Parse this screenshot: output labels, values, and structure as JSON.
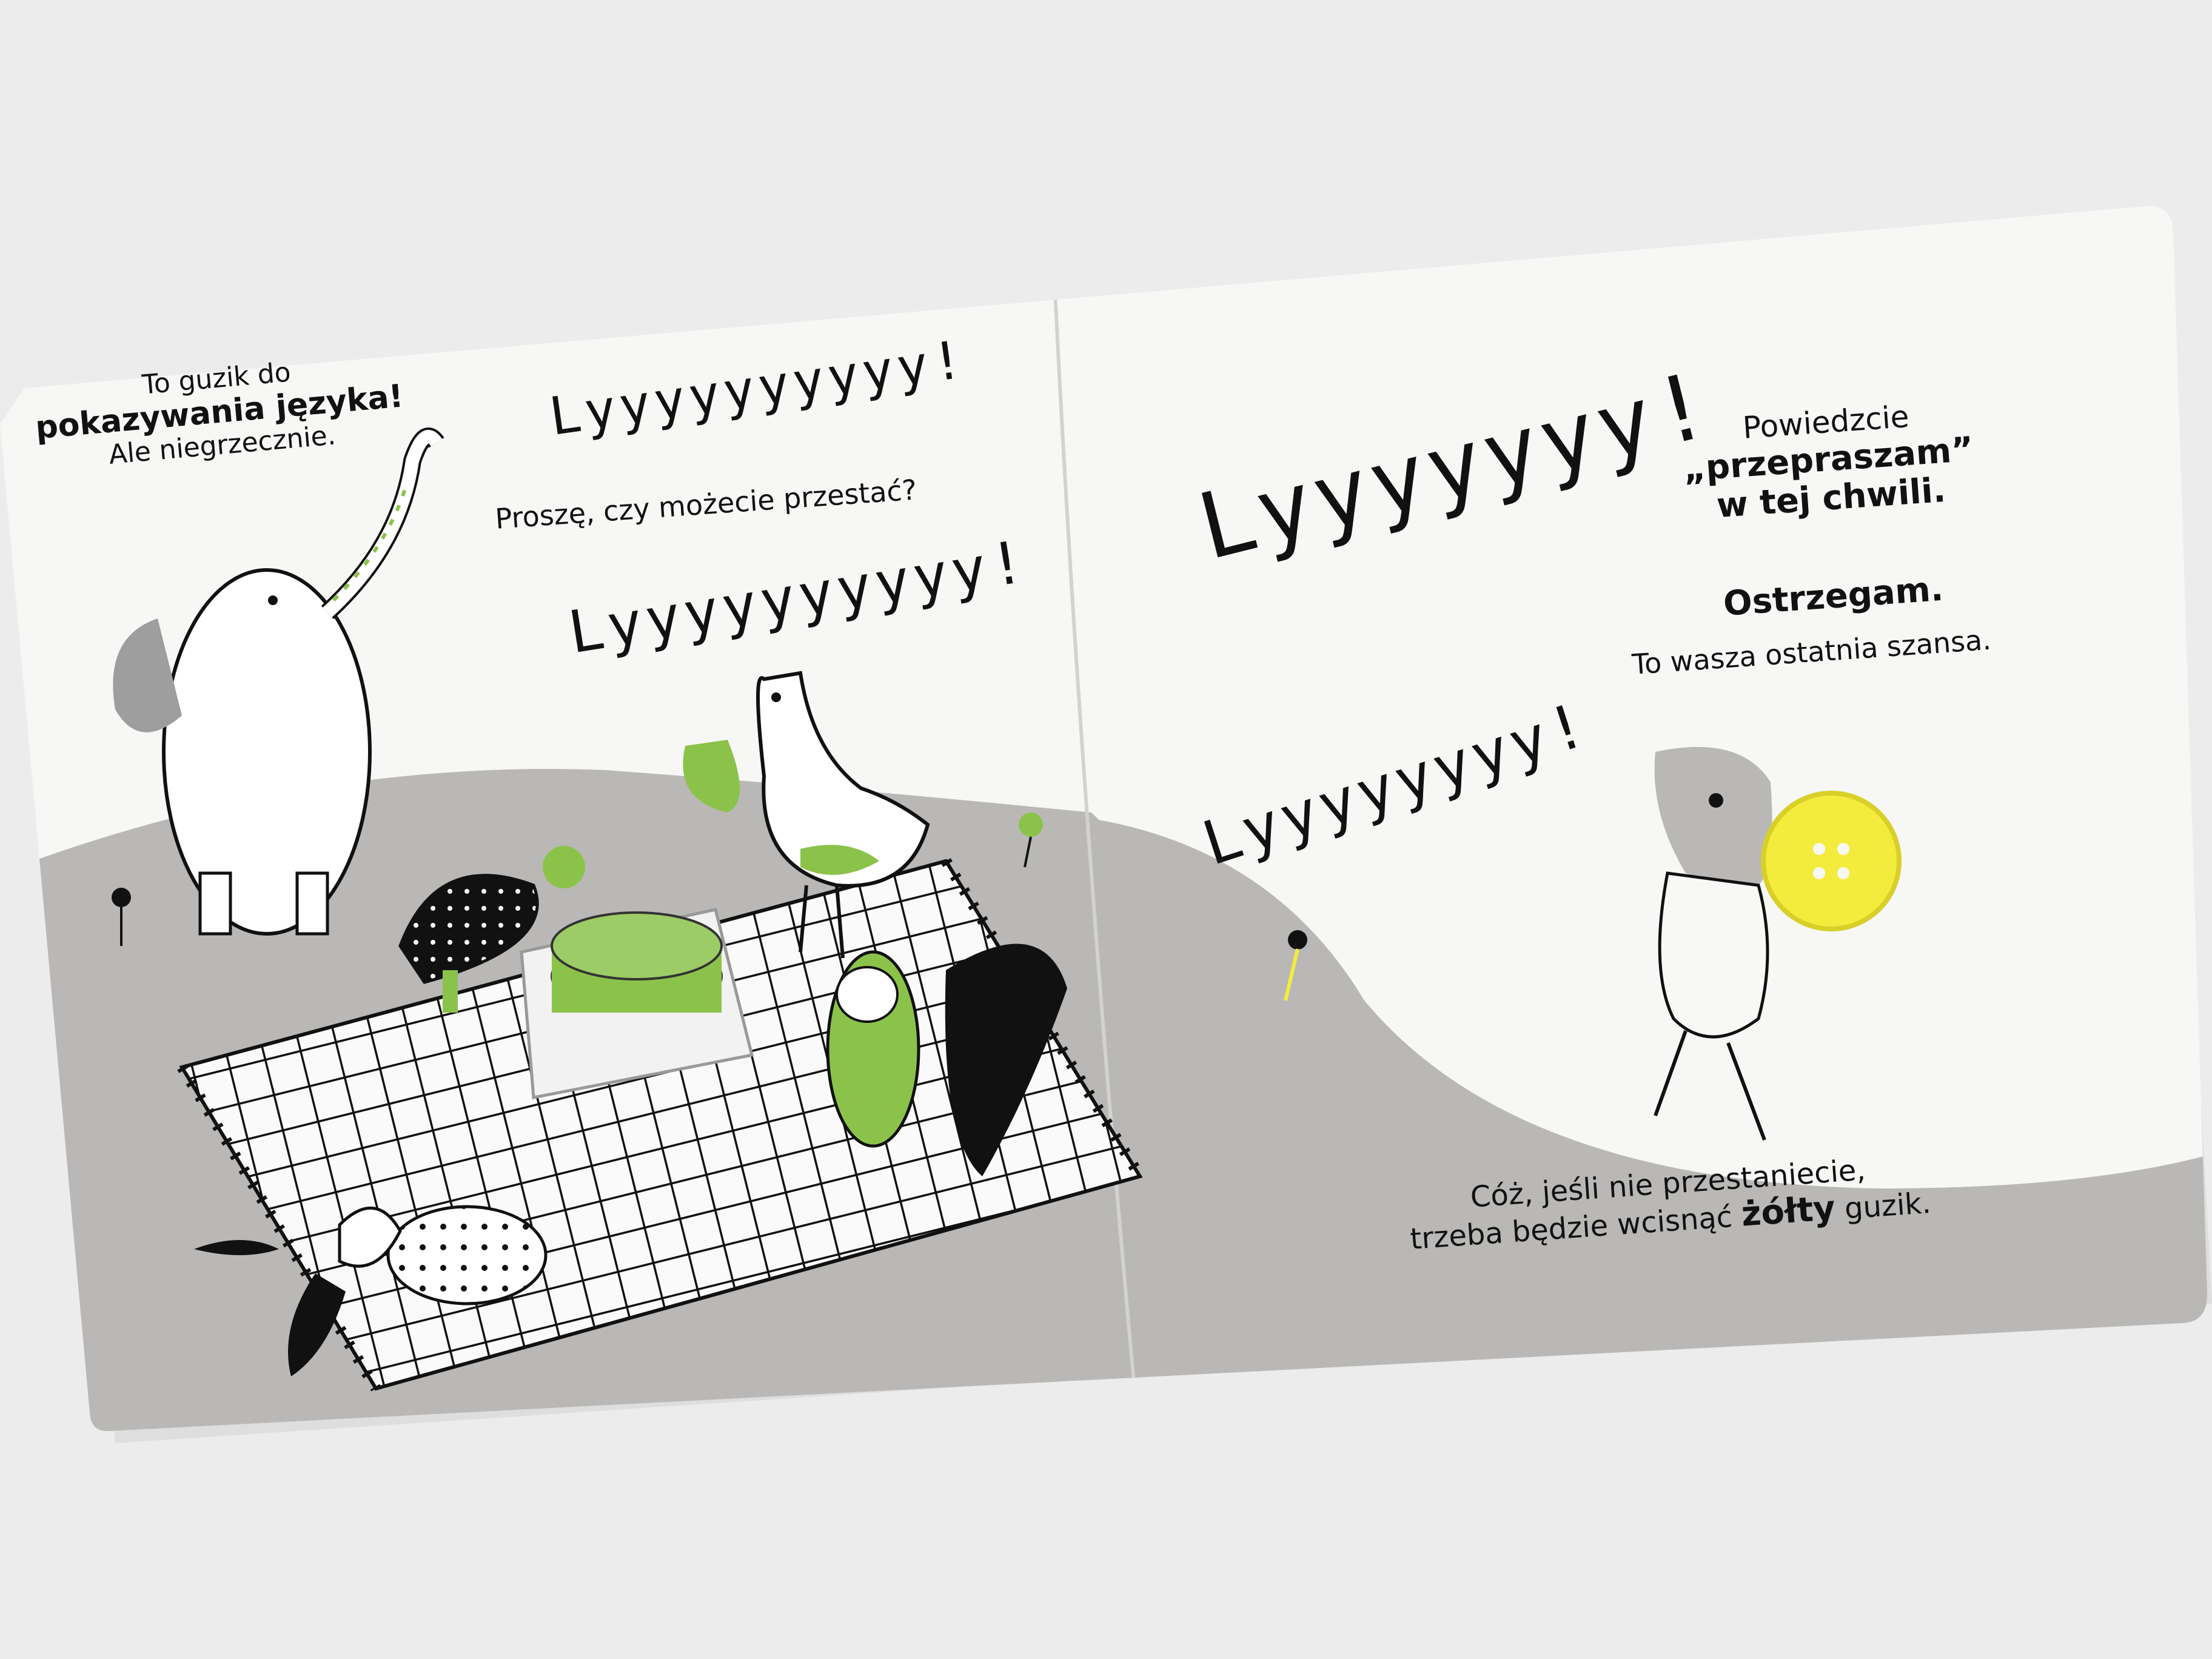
{
  "left_page": {
    "elephant_caption": {
      "line1": "To guzik do",
      "line2": "pokazywania języka!",
      "line3": "Ale niegrzecznie."
    },
    "shout_1": "Lyyyyyyyyyy!",
    "question": "Proszę, czy możecie przestać?",
    "shout_2": "Lyyyyyyyyyy!"
  },
  "right_page": {
    "shout_big": "Lyyyyyyy!",
    "shout_mid": "Lyyyyyyyy!",
    "instruction": {
      "line1": "Powiedzcie",
      "line2": "„przepraszam”",
      "line3": "w tej chwili."
    },
    "warning": "Ostrzegam.",
    "last_chance": "To wasza ostatnia szansa.",
    "footer": {
      "line1": "Cóż, jeśli nie przestaniecie,",
      "line2_start": "trzeba będzie wcisnąć ",
      "line2_emph": "żółty",
      "line2_end": " guzik."
    }
  },
  "colors": {
    "background": "#ececec",
    "page": "#f7f7f6",
    "hill": "#b9b8b6",
    "accent_green": "#8bc34a",
    "button_yellow": "#f4ec3c"
  }
}
